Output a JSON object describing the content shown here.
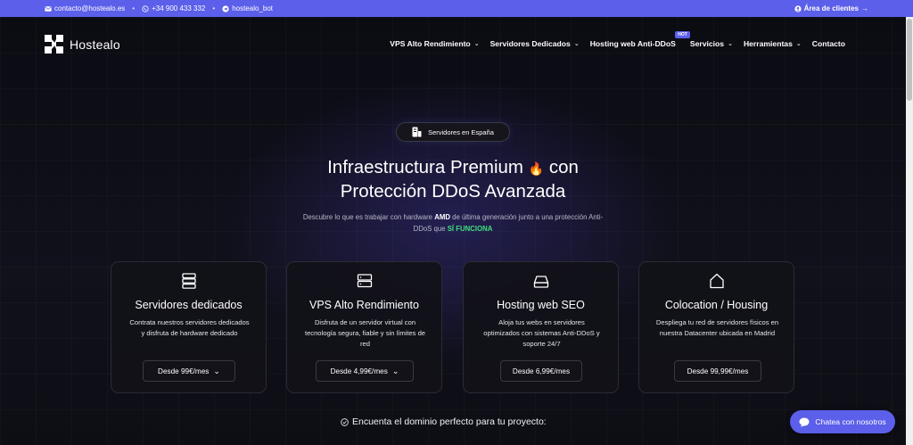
{
  "topbar": {
    "email": "contacto@hostealo.es",
    "phone": "+34 900 433 332",
    "telegram": "hostealo_bot",
    "client_area": "Área de clientes",
    "email_icon": "envelope-icon",
    "phone_icon": "whatsapp-icon",
    "telegram_icon": "telegram-icon",
    "client_icon": "user-circle-icon",
    "arrow_icon": "arrow-right-icon"
  },
  "header": {
    "brand": "Hostealo",
    "nav": [
      {
        "label": "VPS Alto Rendimiento",
        "dropdown": true
      },
      {
        "label": "Servidores Dedicados",
        "dropdown": true
      },
      {
        "label": "Hosting web Anti-DDoS",
        "dropdown": false,
        "badge": "HOT"
      },
      {
        "label": "Servicios",
        "dropdown": true
      },
      {
        "label": "Herramientas",
        "dropdown": true
      },
      {
        "label": "Contacto",
        "dropdown": false
      }
    ]
  },
  "hero": {
    "pill": "Servidores en España",
    "title_line1": "Infraestructura Premium",
    "title_emoji": "🔥",
    "title_line1_end": "con",
    "title_line2": "Protección DDoS Avanzada",
    "desc_part1": "Descubre lo que es trabajar con hardware",
    "desc_bold": "AMD",
    "desc_part2": "de última generación junto a una protección Anti-DDoS que",
    "desc_green": "SÍ FUNCIONA"
  },
  "cards": [
    {
      "icon": "server-stack-icon",
      "title": "Servidores dedicados",
      "desc": "Contrata nuestros servidores dedicados y disfruta de hardware dedicado",
      "price": "Desde 99€/mes",
      "dropdown": true
    },
    {
      "icon": "server-rack-icon",
      "title": "VPS Alto Rendimiento",
      "desc": "Disfruta de un servidor virtual con tecnología segura, fiable y sin límites de red",
      "price": "Desde 4,99€/mes",
      "dropdown": true
    },
    {
      "icon": "hard-drive-icon",
      "title": "Hosting web SEO",
      "desc": "Aloja tus webs en servidores optimizados con sistemas Anti-DDoS y soporte 24/7",
      "price": "Desde 6,99€/mes",
      "dropdown": false
    },
    {
      "icon": "home-icon",
      "title": "Colocation / Housing",
      "desc": "Despliega tu red de servidores físicos en nuestra Datacenter ubicada en Madrid",
      "price": "Desde 99,99€/mes",
      "dropdown": false
    }
  ],
  "domain": {
    "icon": "check-circle-icon",
    "text": "Encuenta el dominio perfecto para tu proyecto:"
  },
  "chat": {
    "icon": "chat-bubble-icon",
    "label": "Chatea con nosotros"
  },
  "colors": {
    "accent": "#5b5fe9",
    "background": "#0d0d14",
    "green": "#3ee07d"
  }
}
